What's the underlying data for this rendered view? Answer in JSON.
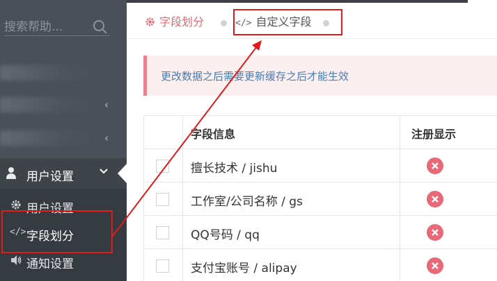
{
  "sidebar": {
    "search_placeholder": "搜索帮助...",
    "group": {
      "label": "用户设置"
    },
    "sub_items": [
      {
        "label": "用户设置",
        "icon": "gear-icon"
      },
      {
        "label": "字段划分",
        "icon": "code-icon"
      },
      {
        "label": "通知设置",
        "icon": "volume-icon"
      }
    ]
  },
  "tabs": [
    {
      "label": "字段划分",
      "icon": "gear-icon"
    },
    {
      "label": "自定义字段",
      "icon": "code-icon"
    }
  ],
  "alert": {
    "text": "更改数据之后需要更新缓存之后才能生效"
  },
  "table": {
    "headers": {
      "name": "字段信息",
      "register": "注册显示"
    },
    "rows": [
      {
        "name": "擅长技术 / jishu"
      },
      {
        "name": "工作室/公司名称 / gs"
      },
      {
        "name": "QQ号码 / qq"
      },
      {
        "name": "支付宝账号 / alipay"
      }
    ]
  },
  "colors": {
    "accent": "#e06a76",
    "annotation": "#e01b1b",
    "sidebar": "#4a5058"
  }
}
